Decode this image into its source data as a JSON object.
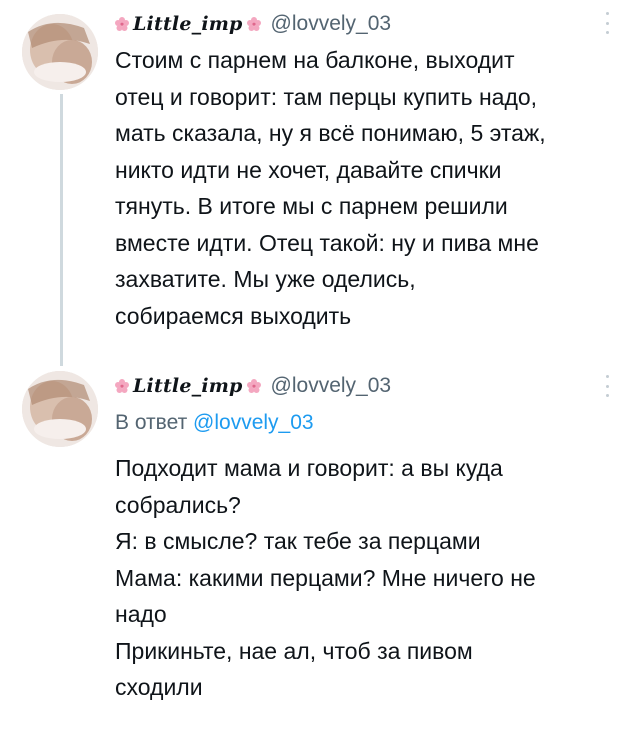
{
  "tweets": [
    {
      "author": {
        "display_name": "Little_imp",
        "name_emoji": "cherry-blossom-icon",
        "handle": "@lovvely_03"
      },
      "more_icon": "more-vertical-icon",
      "text_lines": [
        "Стоим с парнем на балконе, выходит",
        "отец и говорит: там перцы купить надо,",
        "мать сказала, ну я всё понимаю, 5 этаж,",
        "никто идти не хочет, давайте спички",
        "тянуть. В итоге мы с парнем решили",
        "вместе идти. Отец такой: ну и пива мне",
        "захватите. Мы уже оделись,",
        "собираемся выходить"
      ]
    },
    {
      "author": {
        "display_name": "Little_imp",
        "name_emoji": "cherry-blossom-icon",
        "handle": "@lovvely_03"
      },
      "more_icon": "more-vertical-icon",
      "reply_prefix": "В ответ",
      "reply_mention": "@lovvely_03",
      "text_lines": [
        "Подходит мама и говорит: а вы куда",
        "собрались?",
        "Я: в смысле? так тебе за перцами",
        "Мама: какими перцами? Мне ничего не",
        "надо",
        "Прикиньте, нае ал, чтоб за пивом",
        "сходили"
      ]
    }
  ],
  "colors": {
    "text": "#0f1419",
    "secondary": "#536471",
    "link": "#1d9bf0",
    "thread_line": "#cfd9de",
    "flower": "#f4a7c0"
  }
}
